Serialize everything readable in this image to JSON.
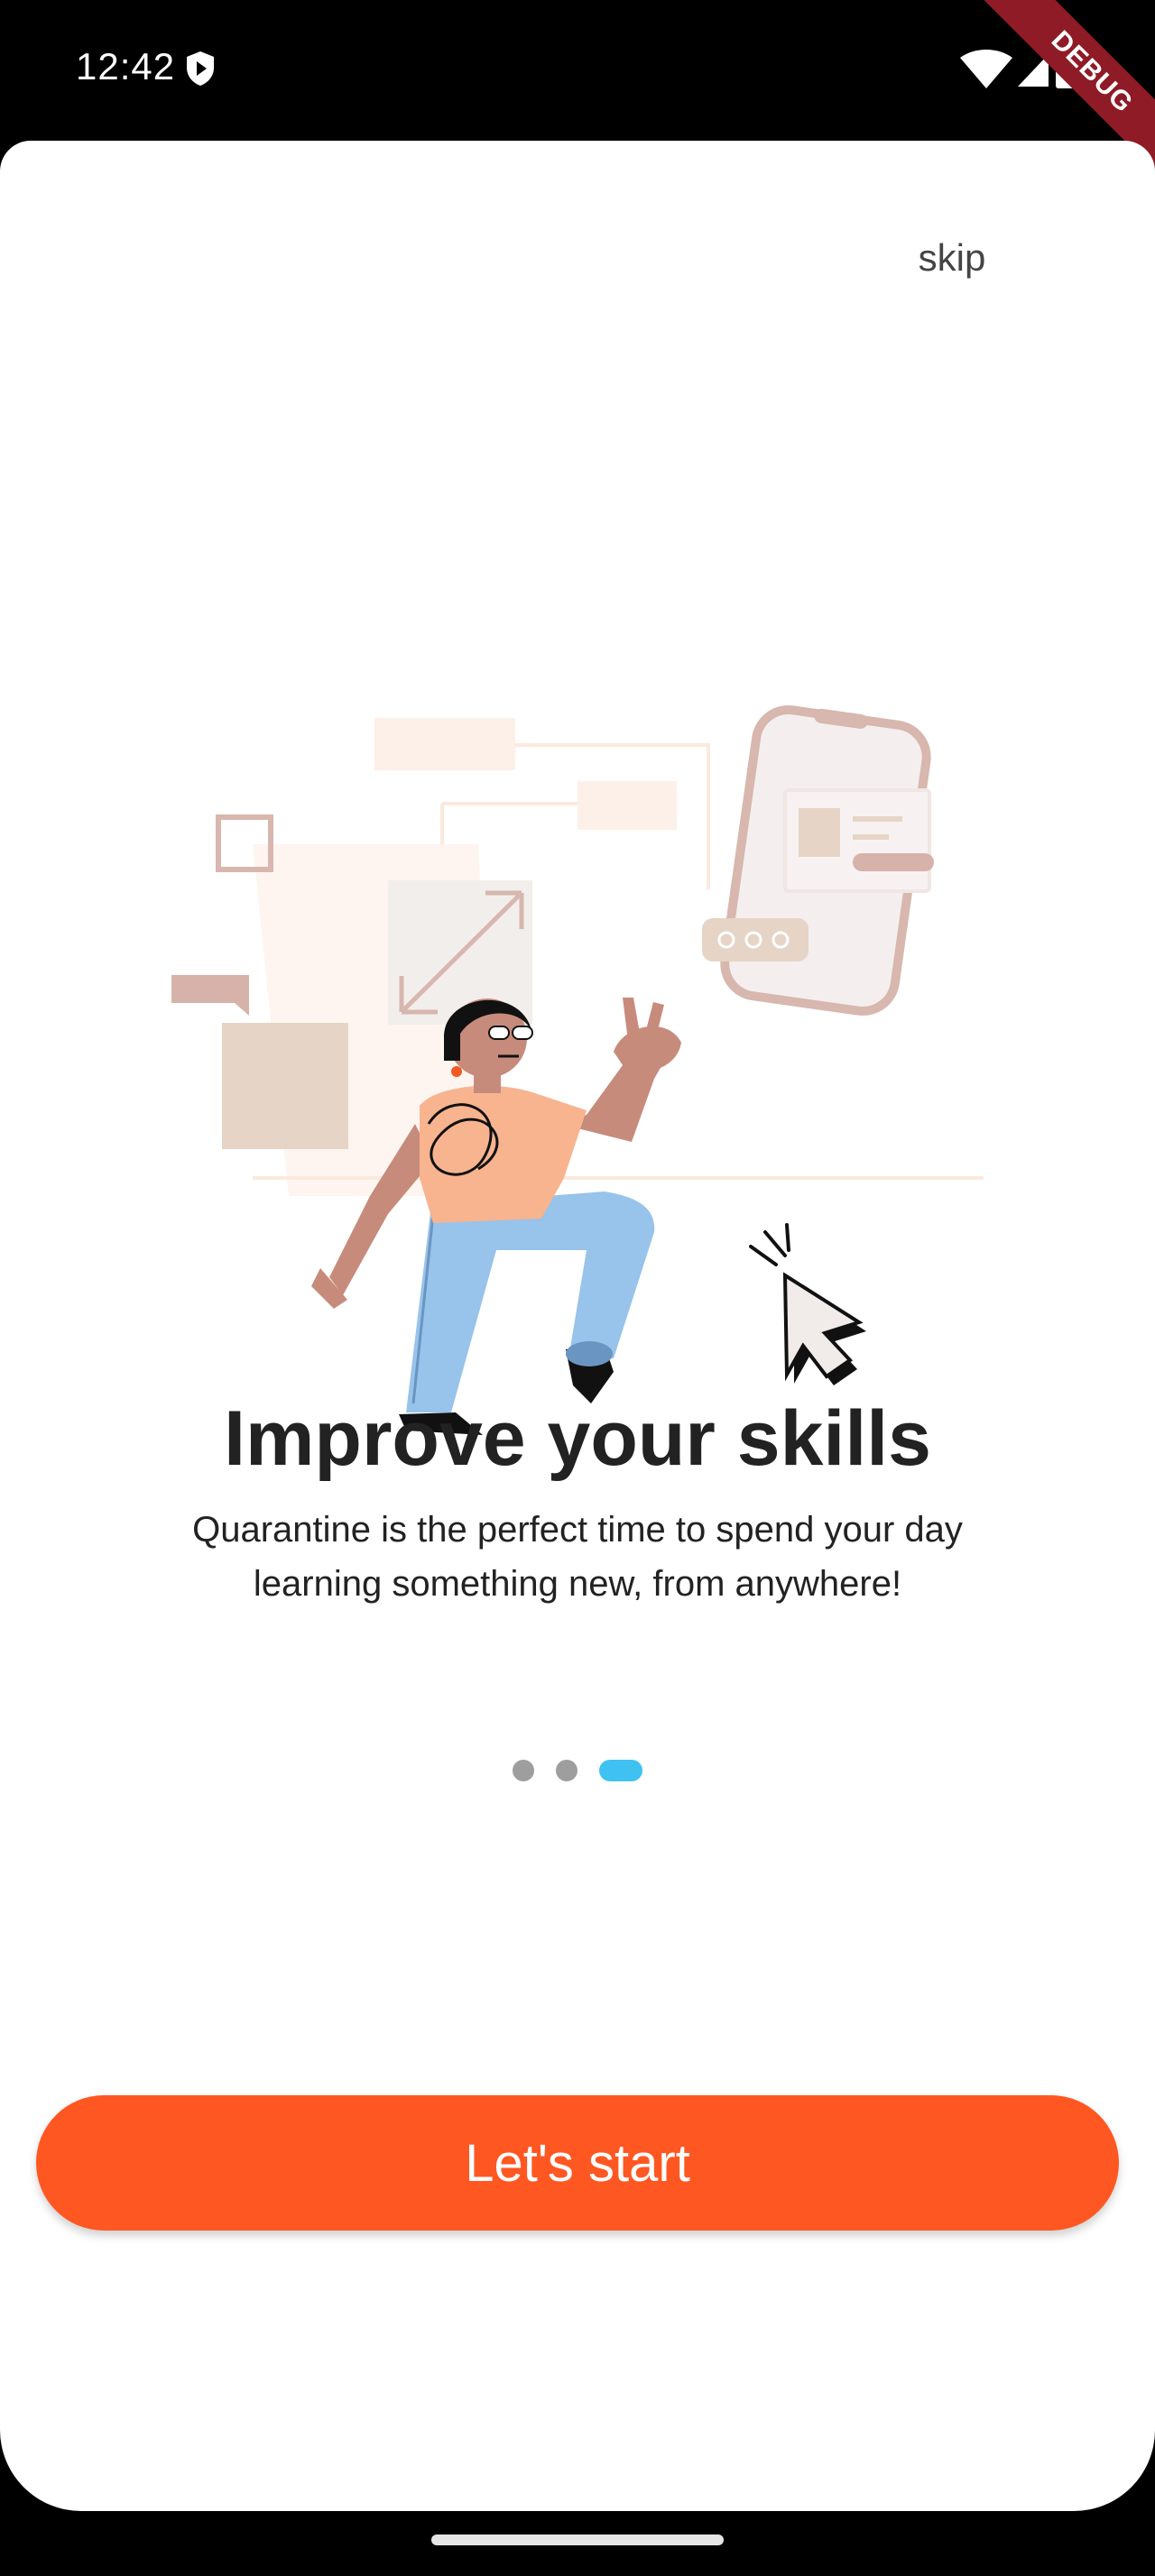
{
  "status_bar": {
    "time": "12:42",
    "debug_label": "DEBUG"
  },
  "onboarding": {
    "skip_label": "skip",
    "title": "Improve your skills",
    "subtitle": "Quarantine is the perfect time to spend your day learning something new, from anywhere!",
    "page_indicator": {
      "total": 3,
      "current": 3
    },
    "cta_label": "Let's start"
  },
  "colors": {
    "accent": "#ff5722",
    "indicator_active": "#3fc2f2",
    "indicator_inactive": "#9e9e9e",
    "title_text": "#222222"
  },
  "icons": [
    "shield-icon",
    "wifi-icon",
    "signal-icon",
    "battery-icon"
  ]
}
